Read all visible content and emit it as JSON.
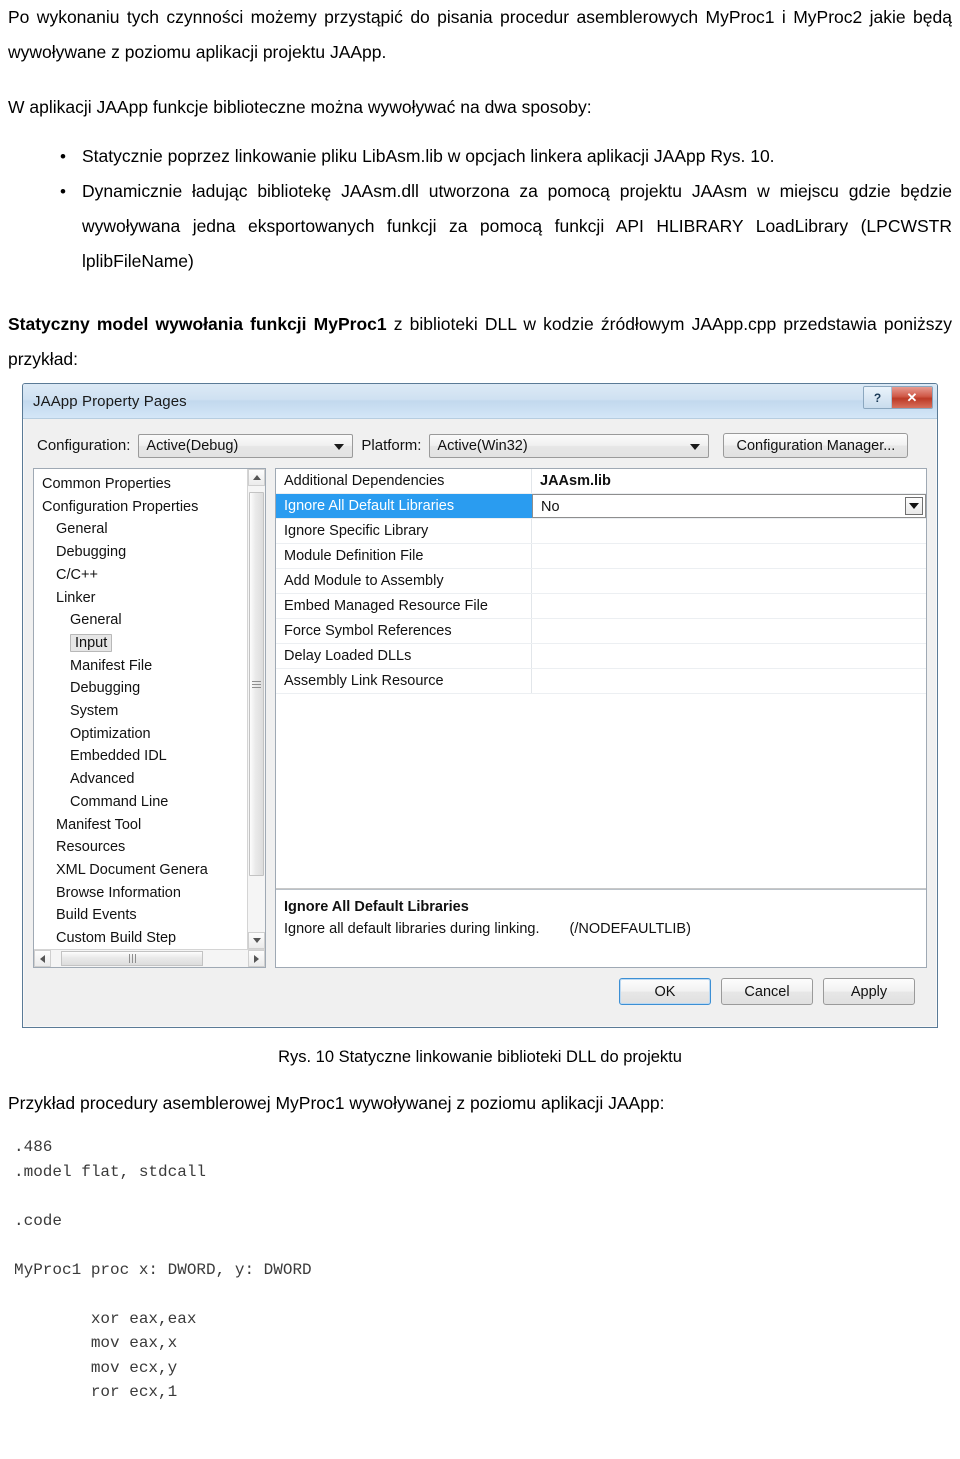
{
  "document": {
    "paragraphs": [
      "Po wykonaniu tych czynności możemy przystąpić do pisania procedur asemblerowych MyProc1 i MyProc2 jakie będą wywoływane z poziomu aplikacji projektu JAApp.",
      "W aplikacji JAApp funkcje biblioteczne można wywoływać na dwa sposoby:"
    ],
    "bullets": [
      "Statycznie poprzez linkowanie pliku LibAsm.lib w opcjach linkera aplikacji JAApp Rys. 10.",
      "Dynamicznie ładując bibliotekę JAAsm.dll utworzona za pomocą projektu JAAsm w miejscu gdzie będzie wywoływana jedna eksportowanych funkcji za pomocą funkcji API HLIBRARY LoadLibrary (LPCWSTR lplibFileName)"
    ],
    "static_model": {
      "bold_prefix": "Statyczny model wywołania funkcji MyProc1",
      "rest": " z biblioteki DLL w kodzie źródłowym JAApp.cpp przedstawia poniższy przykład:"
    },
    "figure_caption": "Rys. 10 Statyczne linkowanie biblioteki DLL do projektu",
    "example_intro": "Przykład procedury asemblerowej MyProc1 wywoływanej z poziomu aplikacji JAApp:",
    "code": ".486\n.model flat, stdcall\n\n.code\n\nMyProc1 proc x: DWORD, y: DWORD\n\n        xor eax,eax\n        mov eax,x\n        mov ecx,y\n        ror ecx,1"
  },
  "dialog": {
    "title": "JAApp Property Pages",
    "window_buttons": {
      "help": "?",
      "close": "✕"
    },
    "configuration": {
      "label": "Configuration:",
      "value": "Active(Debug)"
    },
    "platform": {
      "label": "Platform:",
      "value": "Active(Win32)"
    },
    "configuration_manager_label": "Configuration Manager...",
    "tree": [
      {
        "label": "Common Properties",
        "level": 0,
        "selected": false
      },
      {
        "label": "Configuration Properties",
        "level": 0,
        "selected": false
      },
      {
        "label": "General",
        "level": 1,
        "selected": false
      },
      {
        "label": "Debugging",
        "level": 1,
        "selected": false
      },
      {
        "label": "C/C++",
        "level": 1,
        "selected": false
      },
      {
        "label": "Linker",
        "level": 1,
        "selected": false
      },
      {
        "label": "General",
        "level": 2,
        "selected": false
      },
      {
        "label": "Input",
        "level": 2,
        "selected": true
      },
      {
        "label": "Manifest File",
        "level": 2,
        "selected": false
      },
      {
        "label": "Debugging",
        "level": 2,
        "selected": false
      },
      {
        "label": "System",
        "level": 2,
        "selected": false
      },
      {
        "label": "Optimization",
        "level": 2,
        "selected": false
      },
      {
        "label": "Embedded IDL",
        "level": 2,
        "selected": false
      },
      {
        "label": "Advanced",
        "level": 2,
        "selected": false
      },
      {
        "label": "Command Line",
        "level": 2,
        "selected": false
      },
      {
        "label": "Manifest Tool",
        "level": 1,
        "selected": false
      },
      {
        "label": "Resources",
        "level": 1,
        "selected": false
      },
      {
        "label": "XML Document Genera",
        "level": 1,
        "selected": false
      },
      {
        "label": "Browse Information",
        "level": 1,
        "selected": false
      },
      {
        "label": "Build Events",
        "level": 1,
        "selected": false
      },
      {
        "label": "Custom Build Step",
        "level": 1,
        "selected": false
      }
    ],
    "properties": [
      {
        "name": "Additional Dependencies",
        "value": "JAAsm.lib",
        "bold": true,
        "selected": false,
        "dropdown": false
      },
      {
        "name": "Ignore All Default Libraries",
        "value": "No",
        "bold": false,
        "selected": true,
        "dropdown": true
      },
      {
        "name": "Ignore Specific Library",
        "value": "",
        "bold": false,
        "selected": false,
        "dropdown": false
      },
      {
        "name": "Module Definition File",
        "value": "",
        "bold": false,
        "selected": false,
        "dropdown": false
      },
      {
        "name": "Add Module to Assembly",
        "value": "",
        "bold": false,
        "selected": false,
        "dropdown": false
      },
      {
        "name": "Embed Managed Resource File",
        "value": "",
        "bold": false,
        "selected": false,
        "dropdown": false
      },
      {
        "name": "Force Symbol References",
        "value": "",
        "bold": false,
        "selected": false,
        "dropdown": false
      },
      {
        "name": "Delay Loaded DLLs",
        "value": "",
        "bold": false,
        "selected": false,
        "dropdown": false
      },
      {
        "name": "Assembly Link Resource",
        "value": "",
        "bold": false,
        "selected": false,
        "dropdown": false
      }
    ],
    "description": {
      "title": "Ignore All Default Libraries",
      "text": "Ignore all default libraries during linking.",
      "flag": "(/NODEFAULTLIB)"
    },
    "buttons": {
      "ok": "OK",
      "cancel": "Cancel",
      "apply": "Apply"
    },
    "colors": {
      "selection_blue": "#2a9cf0",
      "titlebar_blue": "#cfe1f2",
      "close_red": "#cf5846"
    }
  }
}
